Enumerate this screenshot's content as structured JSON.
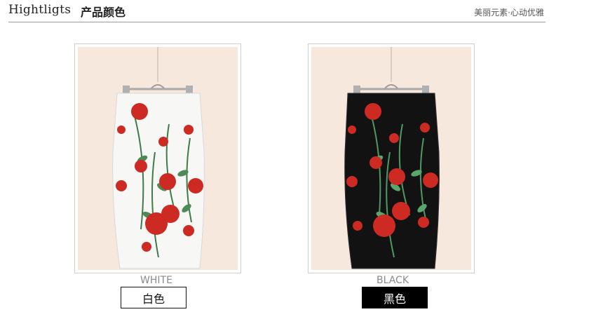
{
  "header": {
    "title_en": "Hightligts",
    "title_cn": "产品颜色",
    "tagline": "美丽元素·心动优雅"
  },
  "colors": {
    "rose": "#cc2a22",
    "leaf": "#3e7a4a",
    "skirt_white": "#f7f7f5",
    "skirt_black": "#121212",
    "backdrop": "#f7e8dd"
  },
  "options": [
    {
      "en": "WHITE",
      "cn": "白色"
    },
    {
      "en": "BLACK",
      "cn": "黑色"
    }
  ]
}
